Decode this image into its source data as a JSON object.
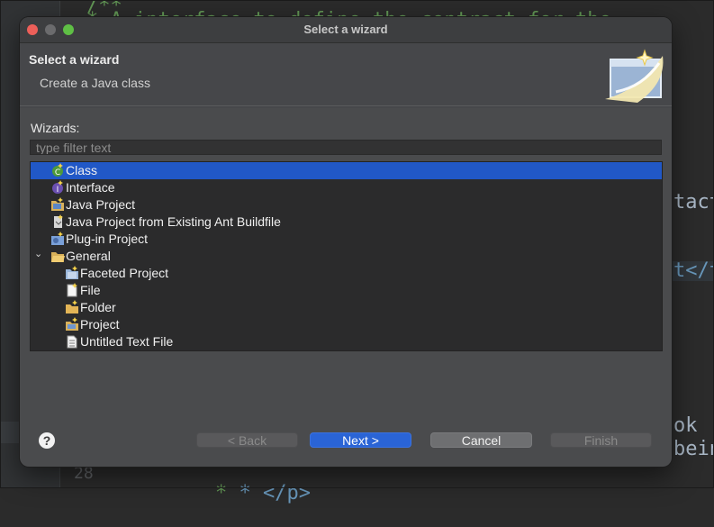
{
  "editor": {
    "top_comment": "/**",
    "top_text": "* A interface to define the contract for the",
    "right_text_1": "tact",
    "right_text_2": "t</t",
    "right_text_3": "ok",
    "right_text_4": "bein",
    "bottom_line_number": "28",
    "bottom_code": "* </p>"
  },
  "window": {
    "title": "Select a wizard"
  },
  "header": {
    "title": "Select a wizard",
    "subtitle": "Create a Java class"
  },
  "wizards": {
    "label": "Wizards:",
    "filter_placeholder": "type filter text",
    "items": [
      {
        "label": "Class",
        "icon": "java-class-icon",
        "selected": true
      },
      {
        "label": "Interface",
        "icon": "java-interface-icon",
        "selected": false
      },
      {
        "label": "Java Project",
        "icon": "java-project-icon",
        "selected": false
      },
      {
        "label": "Java Project from Existing Ant Buildfile",
        "icon": "ant-buildfile-icon",
        "selected": false
      },
      {
        "label": "Plug-in Project",
        "icon": "plugin-project-icon",
        "selected": false
      },
      {
        "label": "General",
        "icon": "folder-open-icon",
        "selected": false,
        "expanded": true
      },
      {
        "label": "Faceted Project",
        "icon": "faceted-project-icon",
        "selected": false
      },
      {
        "label": "File",
        "icon": "new-file-icon",
        "selected": false
      },
      {
        "label": "Folder",
        "icon": "new-folder-icon",
        "selected": false
      },
      {
        "label": "Project",
        "icon": "new-project-icon",
        "selected": false
      },
      {
        "label": "Untitled Text File",
        "icon": "text-file-icon",
        "selected": false
      }
    ]
  },
  "buttons": {
    "help": "?",
    "back": "< Back",
    "next": "Next >",
    "cancel": "Cancel",
    "finish": "Finish"
  },
  "colors": {
    "selection": "#2158c7",
    "primary_button": "#2a64d6"
  }
}
